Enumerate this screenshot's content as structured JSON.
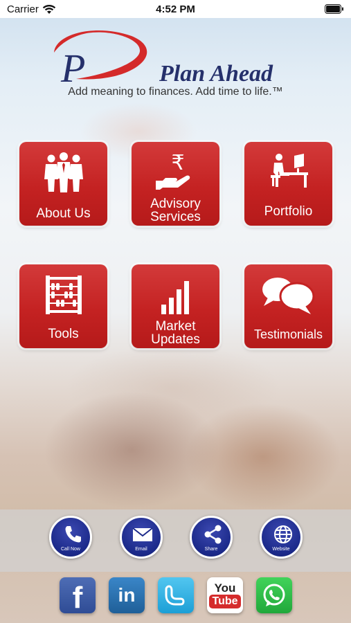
{
  "status_bar": {
    "carrier": "Carrier",
    "time": "4:52 PM"
  },
  "brand": {
    "logo_letter": "P",
    "name": "Plan Ahead",
    "tagline": "Add meaning to finances. Add time to life.™",
    "colors": {
      "navy": "#25306b",
      "swoosh": "#d42a2a"
    }
  },
  "tiles": [
    {
      "label": "About Us",
      "icon": "people-icon"
    },
    {
      "label": "Advisory Services",
      "line1": "Advisory",
      "line2": "Services",
      "icon": "rupee-hand-icon"
    },
    {
      "label": "Portfolio",
      "icon": "desk-worker-icon"
    },
    {
      "label": "Tools",
      "icon": "abacus-icon"
    },
    {
      "label": "Market Updates",
      "line1": "Market",
      "line2": "Updates",
      "icon": "bar-chart-icon"
    },
    {
      "label": "Testimonials",
      "icon": "speech-bubbles-icon"
    }
  ],
  "actions": [
    {
      "label": "Call Now",
      "icon": "phone-icon"
    },
    {
      "label": "Email",
      "icon": "envelope-icon"
    },
    {
      "label": "Share",
      "icon": "share-icon"
    },
    {
      "label": "Website",
      "icon": "globe-icon"
    }
  ],
  "social": [
    {
      "name": "Facebook",
      "glyph": "f",
      "icon": "facebook-icon",
      "color": "#3b5998"
    },
    {
      "name": "LinkedIn",
      "glyph": "in",
      "icon": "linkedin-icon",
      "color": "#2a6ea8"
    },
    {
      "name": "Twitter",
      "icon": "twitter-icon",
      "color": "#33b6e8"
    },
    {
      "name": "YouTube",
      "glyph1": "You",
      "glyph2": "Tube",
      "icon": "youtube-icon",
      "color": "#d52b2b"
    },
    {
      "name": "WhatsApp",
      "icon": "whatsapp-icon",
      "color": "#2bb741"
    }
  ]
}
